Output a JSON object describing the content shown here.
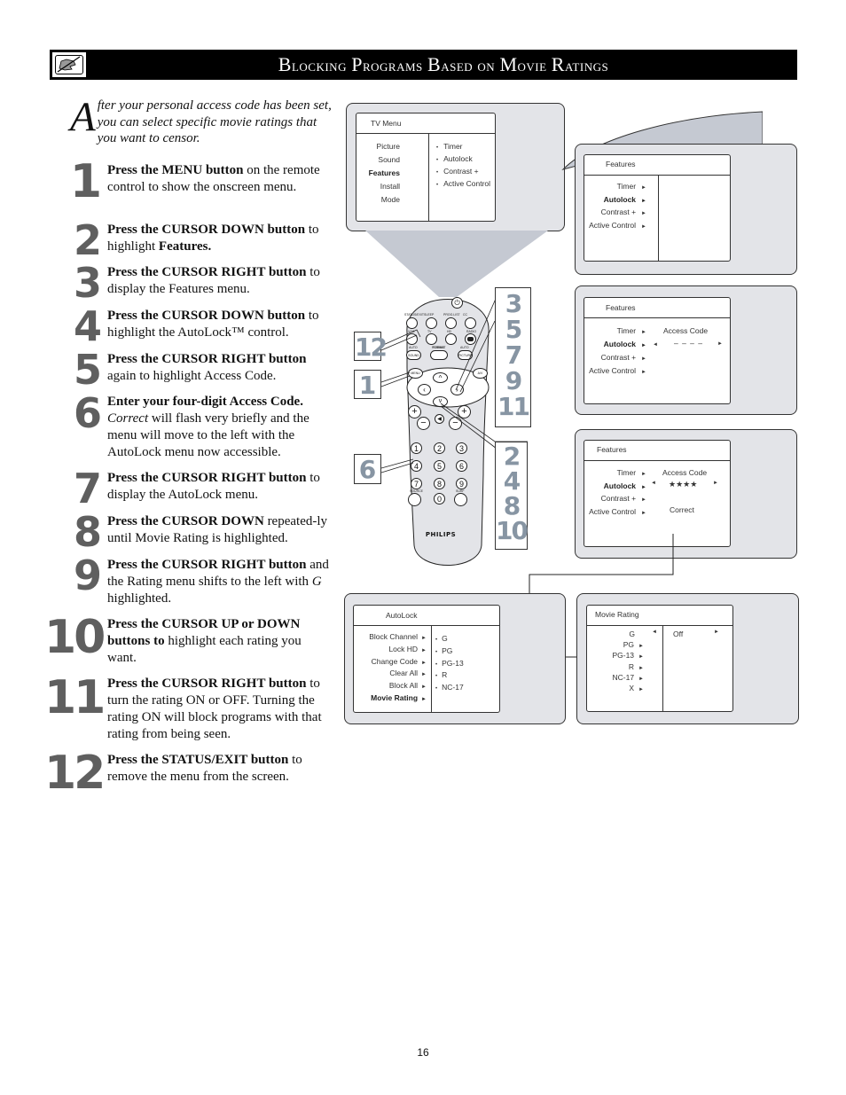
{
  "header": {
    "title_parts": [
      {
        "cap": "B",
        "rest": "locking"
      },
      {
        "cap": "P",
        "rest": "rograms"
      },
      {
        "cap": "B",
        "rest": "ased"
      },
      {
        "cap": "",
        "rest": "on"
      },
      {
        "cap": "M",
        "rest": "ovie"
      },
      {
        "cap": "R",
        "rest": "atings"
      }
    ],
    "title": "Blocking Programs Based on Movie Ratings",
    "icon": "no-hand-icon"
  },
  "intro": {
    "dropcap": "A",
    "text": "fter your personal access code has been set, you can select specific movie ratings that you want to censor."
  },
  "steps": [
    {
      "num": "1",
      "bold": "Press the MENU button",
      "text": " on the remote control to show the onscreen menu."
    },
    {
      "num": "2",
      "bold": "Press the CURSOR  DOWN button",
      "text": " to highlight ",
      "bold2": "Features."
    },
    {
      "num": "3",
      "bold": "Press the CURSOR RIGHT button",
      "text": " to display the Features menu."
    },
    {
      "num": "4",
      "bold": "Press the CURSOR DOWN button",
      "text": " to highlight the AutoLock™ control."
    },
    {
      "num": "5",
      "bold": "Press the CURSOR RIGHT button",
      "text": " again to highlight Access Code."
    },
    {
      "num": "6",
      "bold": "Enter your four-digit Access Code.",
      "italic": "Correct",
      "text": " will flash very briefly and the menu will move to the left with the AutoLock menu now accessible."
    },
    {
      "num": "7",
      "bold": "Press the CURSOR RIGHT button",
      "text": " to display the AutoLock menu."
    },
    {
      "num": "8",
      "bold": "Press the CURSOR DOWN",
      "text": " repeated-ly until Movie Rating is highlighted."
    },
    {
      "num": "9",
      "bold": "Press the CURSOR RIGHT button",
      "text": " and the Rating menu shifts to the left with ",
      "italic2": "G",
      "text2": " highlighted."
    },
    {
      "num": "10",
      "bold": "Press the CURSOR UP or DOWN buttons to",
      "text": " highlight each rating you want."
    },
    {
      "num": "11",
      "bold": "Press the CURSOR RIGHT button",
      "text": " to turn the rating ON or OFF.  Turning the rating ON will block programs with that rating from being seen."
    },
    {
      "num": "12",
      "bold": "Press the STATUS/EXIT button",
      "text": " to remove the menu from the screen."
    }
  ],
  "tv_menu": {
    "title": "TV Menu",
    "left": [
      "Picture",
      "Sound",
      "Features",
      "Install",
      "Mode"
    ],
    "selected": "Features",
    "right": [
      "Timer",
      "Autolock",
      "Contrast +",
      "Active Control"
    ],
    "bullet": "•"
  },
  "features_menu_1": {
    "title": "Features",
    "items": [
      "Timer",
      "Autolock",
      "Contrast +",
      "Active Control"
    ],
    "selected": "Autolock",
    "arrow": "►"
  },
  "features_menu_2": {
    "title": "Features",
    "items": [
      "Timer",
      "Autolock",
      "Contrast +",
      "Active Control"
    ],
    "selected": "Autolock",
    "access_label": "Access Code",
    "access_value": "– – – –",
    "left_arrow": "◄",
    "right_arrow": "►"
  },
  "features_menu_3": {
    "title": "Features",
    "items": [
      "Timer",
      "Autolock",
      "Contrast +",
      "Active Control"
    ],
    "selected": "Autolock",
    "access_label": "Access Code",
    "access_value": "★★★★",
    "status": "Correct"
  },
  "autolock_menu": {
    "title": "AutoLock",
    "items": [
      "Block Channel",
      "Lock HD",
      "Change Code",
      "Clear All",
      "Block All",
      "Movie Rating"
    ],
    "selected": "Movie Rating",
    "ratings": [
      "G",
      "PG",
      "PG-13",
      "R",
      "NC-17"
    ]
  },
  "movie_rating_menu": {
    "title": "Movie Rating",
    "items": [
      "G",
      "PG",
      "PG-13",
      "R",
      "NC-17",
      "X"
    ],
    "selected": "G",
    "value": "Off"
  },
  "remote": {
    "brand": "PHILIPS",
    "top_labels": [
      "STATUS/EXIT",
      "SLEEP",
      "PROG.LIST",
      "CC"
    ],
    "row2_labels": [
      "VGA",
      "TV",
      "HD",
      "RADIO"
    ],
    "row3_labels": [
      "AUTO",
      "FORMAT",
      "AUTO"
    ],
    "row3_buttons": [
      "SOUND",
      "",
      "PICTURE"
    ],
    "menu_label": "MENU",
    "av_label": "A/V",
    "source_label": "SOURCE",
    "surf_label": "SURF",
    "digits": [
      "1",
      "2",
      "3",
      "4",
      "5",
      "6",
      "7",
      "8",
      "9",
      "0"
    ]
  },
  "callouts": {
    "left_12": "12",
    "left_1": "1",
    "left_6": "6",
    "right_top": [
      "3",
      "5",
      "7",
      "9",
      "11"
    ],
    "right_bottom": [
      "2",
      "4",
      "8",
      "10"
    ]
  },
  "page_number": "16"
}
